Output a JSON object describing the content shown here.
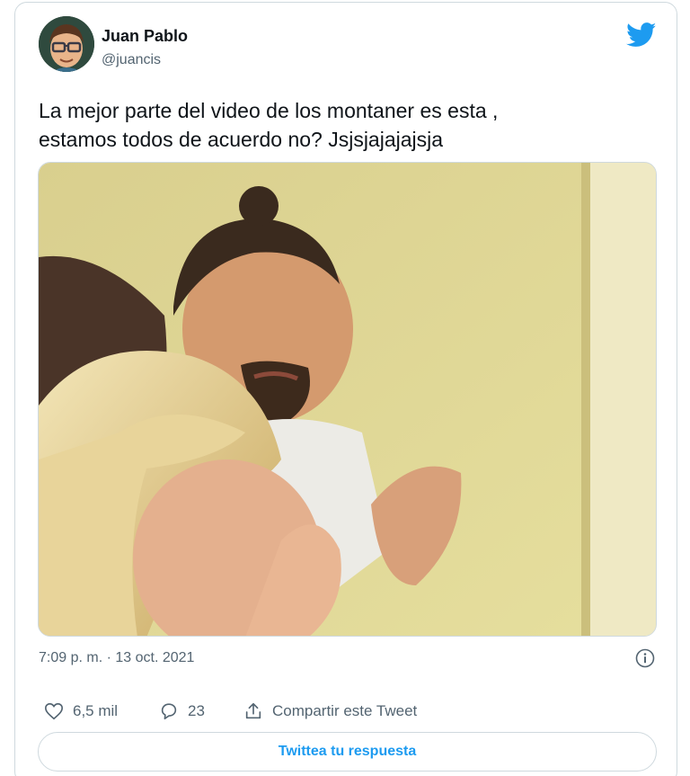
{
  "user": {
    "name": "Juan Pablo",
    "handle": "@juancis",
    "avatar_icon": "cartoon-avatar-with-glasses"
  },
  "brand": {
    "icon": "twitter-bird-icon",
    "color": "#1d9bf0"
  },
  "tweet": {
    "text_line1": "La mejor parte del video de los montaner es esta ,",
    "text_line2": "estamos todos de acuerdo no? Jsjsjajajajsja",
    "media_icon": "video-still-image",
    "timestamp": "7:09 p. m. · 13 oct. 2021"
  },
  "actions": {
    "likes": {
      "icon": "heart-icon",
      "label": "6,5 mil"
    },
    "replies": {
      "icon": "reply-bubble-icon",
      "label": "23"
    },
    "share": {
      "icon": "share-icon",
      "label": "Compartir este Tweet"
    }
  },
  "reply_button": {
    "label": "Twittea tu respuesta"
  },
  "colors": {
    "text": "#0f1419",
    "secondary": "#536471",
    "border": "#cfd9de",
    "accent": "#1d9bf0"
  }
}
